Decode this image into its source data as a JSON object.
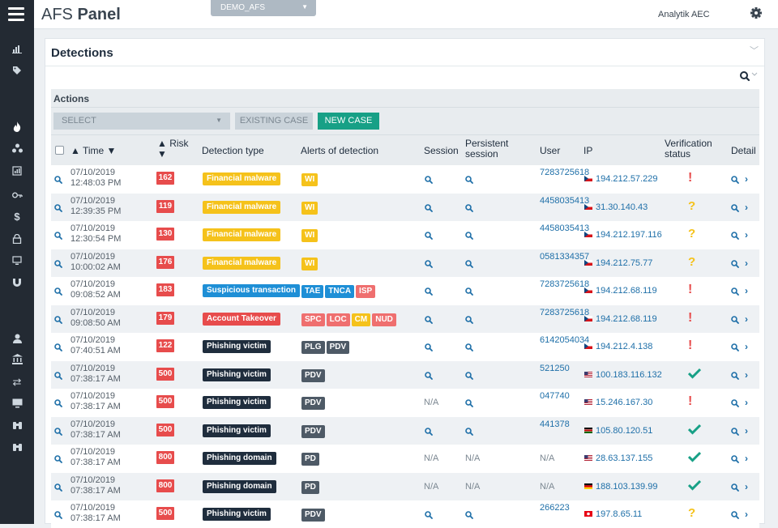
{
  "app": {
    "title_prefix": "AFS",
    "title_main": "Panel",
    "profile": "DEMO_AFS",
    "user": "Analytik AEC"
  },
  "panel": {
    "title": "Detections"
  },
  "actions": {
    "label": "Actions",
    "select_placeholder": "SELECT",
    "existing_case": "EXISTING CASE",
    "new_case": "NEW CASE"
  },
  "columns": {
    "time": "▲ Time ▼",
    "risk1": "▲ Risk",
    "risk2": "▼",
    "detection_type": "Detection type",
    "alerts": "Alerts of detection",
    "session": "Session",
    "persistent1": "Persistent",
    "persistent2": "session",
    "user": "User",
    "ip": "IP",
    "verif1": "Verification",
    "verif2": "status",
    "detail": "Detail"
  },
  "colors": {
    "financial_malware": "#f5c21b",
    "suspicious_transaction": "#1e8fd6",
    "account_takeover": "#e74c4c",
    "phishing": "#1f2d3d",
    "risk": "#e74c4c",
    "new_case": "#17a086",
    "link": "#1e6fa8",
    "verified": "#17a086",
    "warning": "#f5c21b",
    "alert": "#e74c4c"
  },
  "rows": [
    {
      "time": "07/10/2019 12:48:03 PM",
      "risk": "162",
      "type": "Financial malware",
      "type_color": "#f5c21b",
      "alerts": [
        {
          "label": "WI",
          "color": "#f5c21b"
        }
      ],
      "session": "search",
      "persistent": "search",
      "user": "7283725618",
      "ip": "194.212.57.229",
      "flag": "cz",
      "status": "alert"
    },
    {
      "time": "07/10/2019 12:39:35 PM",
      "risk": "119",
      "type": "Financial malware",
      "type_color": "#f5c21b",
      "alerts": [
        {
          "label": "WI",
          "color": "#f5c21b"
        }
      ],
      "session": "search",
      "persistent": "search",
      "user": "4458035413",
      "ip": "31.30.140.43",
      "flag": "cz",
      "status": "warning"
    },
    {
      "time": "07/10/2019 12:30:54 PM",
      "risk": "130",
      "type": "Financial malware",
      "type_color": "#f5c21b",
      "alerts": [
        {
          "label": "WI",
          "color": "#f5c21b"
        }
      ],
      "session": "search",
      "persistent": "search",
      "user": "4458035413",
      "ip": "194.212.197.116",
      "flag": "cz",
      "status": "warning"
    },
    {
      "time": "07/10/2019 10:00:02 AM",
      "risk": "176",
      "type": "Financial malware",
      "type_color": "#f5c21b",
      "alerts": [
        {
          "label": "WI",
          "color": "#f5c21b"
        }
      ],
      "session": "search",
      "persistent": "search",
      "user": "0581334357",
      "ip": "194.212.75.77",
      "flag": "cz",
      "status": "warning"
    },
    {
      "time": "07/10/2019 09:08:52 AM",
      "risk": "183",
      "type": "Suspicious transaction",
      "type_color": "#1e8fd6",
      "alerts": [
        {
          "label": "TAE",
          "color": "#1e8fd6"
        },
        {
          "label": "TNCA",
          "color": "#1e8fd6"
        },
        {
          "label": "ISP",
          "color": "#ef6f6f"
        }
      ],
      "session": "search",
      "persistent": "search",
      "user": "7283725618",
      "ip": "194.212.68.119",
      "flag": "cz",
      "status": "alert"
    },
    {
      "time": "07/10/2019 09:08:50 AM",
      "risk": "179",
      "type": "Account Takeover",
      "type_color": "#e74c4c",
      "alerts": [
        {
          "label": "SPC",
          "color": "#ef6f6f"
        },
        {
          "label": "LOC",
          "color": "#ef6f6f"
        },
        {
          "label": "CM",
          "color": "#f5c21b"
        },
        {
          "label": "NUD",
          "color": "#ef6f6f"
        }
      ],
      "session": "search",
      "persistent": "search",
      "user": "7283725618",
      "ip": "194.212.68.119",
      "flag": "cz",
      "status": "alert"
    },
    {
      "time": "07/10/2019 07:40:51 AM",
      "risk": "122",
      "type": "Phishing victim",
      "type_color": "#1f2d3d",
      "alerts": [
        {
          "label": "PLG",
          "color": "#4e5a66"
        },
        {
          "label": "PDV",
          "color": "#4e5a66"
        }
      ],
      "session": "search",
      "persistent": "search",
      "user": "6142054034",
      "ip": "194.212.4.138",
      "flag": "cz",
      "status": "alert"
    },
    {
      "time": "07/10/2019 07:38:17 AM",
      "risk": "500",
      "type": "Phishing victim",
      "type_color": "#1f2d3d",
      "alerts": [
        {
          "label": "PDV",
          "color": "#4e5a66"
        }
      ],
      "session": "search",
      "persistent": "search",
      "user": "521250",
      "ip": "100.183.116.132",
      "flag": "us",
      "status": "verified"
    },
    {
      "time": "07/10/2019 07:38:17 AM",
      "risk": "500",
      "type": "Phishing victim",
      "type_color": "#1f2d3d",
      "alerts": [
        {
          "label": "PDV",
          "color": "#4e5a66"
        }
      ],
      "session": "N/A",
      "persistent": "search",
      "user": "047740",
      "ip": "15.246.167.30",
      "flag": "us",
      "status": "alert"
    },
    {
      "time": "07/10/2019 07:38:17 AM",
      "risk": "500",
      "type": "Phishing victim",
      "type_color": "#1f2d3d",
      "alerts": [
        {
          "label": "PDV",
          "color": "#4e5a66"
        }
      ],
      "session": "search",
      "persistent": "search",
      "user": "441378",
      "ip": "105.80.120.51",
      "flag": "ke",
      "status": "verified"
    },
    {
      "time": "07/10/2019 07:38:17 AM",
      "risk": "800",
      "type": "Phishing domain",
      "type_color": "#1f2d3d",
      "alerts": [
        {
          "label": "PD",
          "color": "#4e5a66"
        }
      ],
      "session": "N/A",
      "persistent": "N/A",
      "user": "N/A",
      "ip": "28.63.137.155",
      "flag": "us",
      "status": "verified"
    },
    {
      "time": "07/10/2019 07:38:17 AM",
      "risk": "800",
      "type": "Phishing domain",
      "type_color": "#1f2d3d",
      "alerts": [
        {
          "label": "PD",
          "color": "#4e5a66"
        }
      ],
      "session": "N/A",
      "persistent": "N/A",
      "user": "N/A",
      "ip": "188.103.139.99",
      "flag": "de",
      "status": "verified"
    },
    {
      "time": "07/10/2019 07:38:17 AM",
      "risk": "500",
      "type": "Phishing victim",
      "type_color": "#1f2d3d",
      "alerts": [
        {
          "label": "PDV",
          "color": "#4e5a66"
        }
      ],
      "session": "search",
      "persistent": "search",
      "user": "266223",
      "ip": "197.8.65.11",
      "flag": "tn",
      "status": "warning"
    }
  ]
}
